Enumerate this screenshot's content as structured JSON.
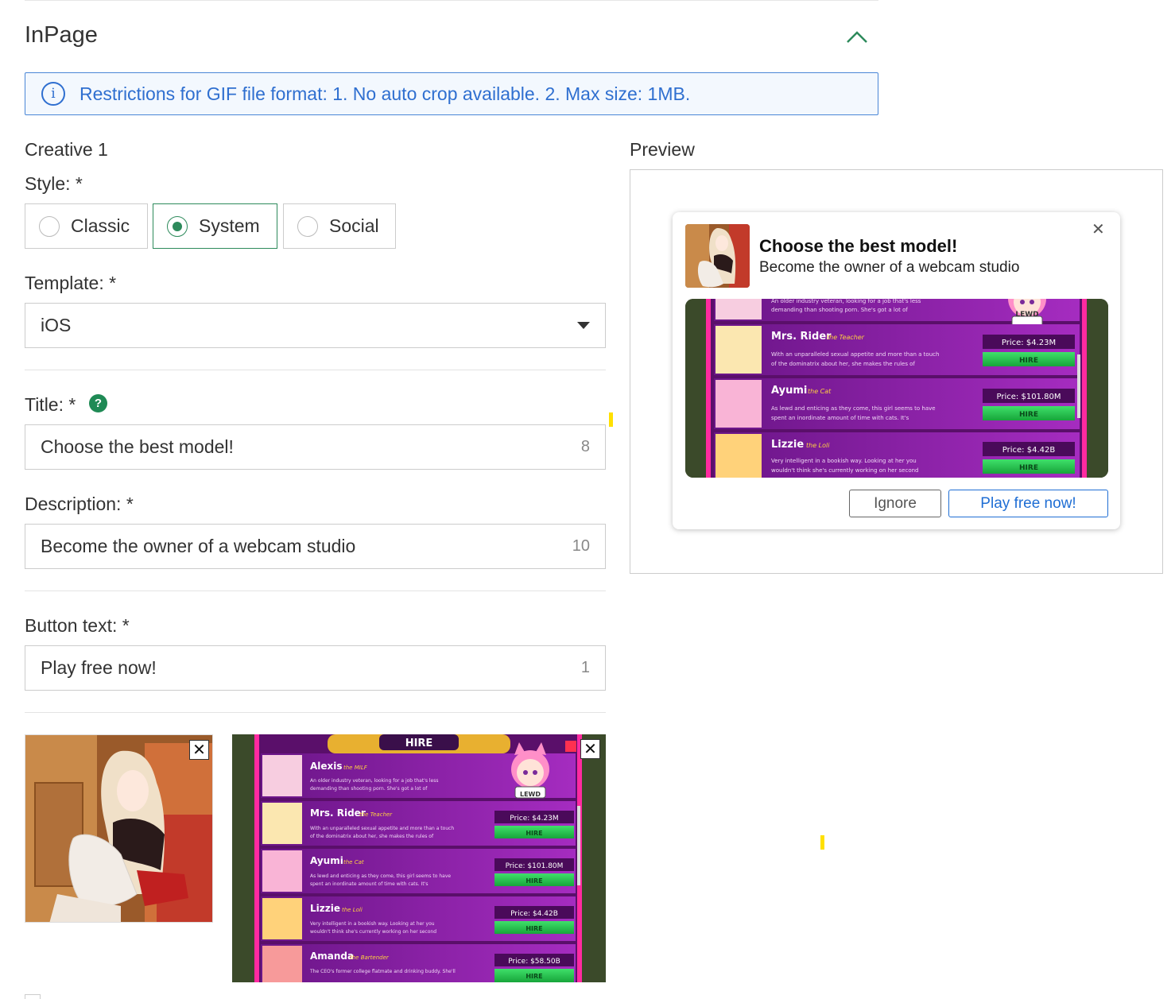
{
  "section": {
    "title": "InPage"
  },
  "alert": {
    "text": "Restrictions for GIF file format: 1. No auto crop available. 2. Max size: 1MB."
  },
  "creative": {
    "label": "Creative 1"
  },
  "style": {
    "label": "Style: *",
    "options": [
      {
        "label": "Classic",
        "selected": false
      },
      {
        "label": "System",
        "selected": true
      },
      {
        "label": "Social",
        "selected": false
      }
    ]
  },
  "template": {
    "label": "Template: *",
    "value": "iOS"
  },
  "title_field": {
    "label": "Title: *",
    "value": "Choose the best model!",
    "counter": "8"
  },
  "description_field": {
    "label": "Description: *",
    "value": "Become the owner of a webcam studio",
    "counter": "10"
  },
  "button_field": {
    "label": "Button text: *",
    "value": "Play free now!",
    "counter": "1"
  },
  "preview": {
    "label": "Preview",
    "notification": {
      "title": "Choose the best model!",
      "description": "Become the owner of a webcam studio",
      "ignore_label": "Ignore",
      "play_label": "Play free now!"
    }
  },
  "game_image": {
    "header": "HIRE",
    "badge": "LEWD",
    "rows": [
      {
        "name": "Alexis",
        "role": "the MILF",
        "desc1": "An older industry veteran, looking for a job that's less",
        "desc2": "demanding than shooting porn. She's got a lot of",
        "price": "",
        "hire": ""
      },
      {
        "name": "Mrs. Rider",
        "role": "the Teacher",
        "desc1": "With an unparalleled sexual appetite and more than a touch",
        "desc2": "of the dominatrix about her, she makes the rules of",
        "price": "Price: $4.23M",
        "hire": "HIRE"
      },
      {
        "name": "Ayumi",
        "role": "the Cat",
        "desc1": "As lewd and enticing as they come, this girl seems to have",
        "desc2": "spent an inordinate amount of time with cats. It's",
        "price": "Price: $101.80M",
        "hire": "HIRE"
      },
      {
        "name": "Lizzie",
        "role": "the Loli",
        "desc1": "Very intelligent in a bookish way. Looking at her you",
        "desc2": "wouldn't think she's currently working on her second",
        "price": "Price: $4.42B",
        "hire": "HIRE"
      },
      {
        "name": "Amanda",
        "role": "the Bartender",
        "desc1": "The CEO's former college flatmate and drinking buddy. She'll",
        "desc2": "",
        "price": "Price: $58.50B",
        "hire": "HIRE"
      }
    ]
  },
  "colors": {
    "accent_green": "#2d8a5b",
    "info_blue": "#2f6fd0",
    "cta_blue": "#1f6ed4",
    "game_purple": "#8e1fa6"
  },
  "icons": {
    "collapse": "chevron-up-icon",
    "info": "info-icon",
    "help": "question-icon",
    "close": "close-icon",
    "dropdown": "caret-down-icon"
  }
}
